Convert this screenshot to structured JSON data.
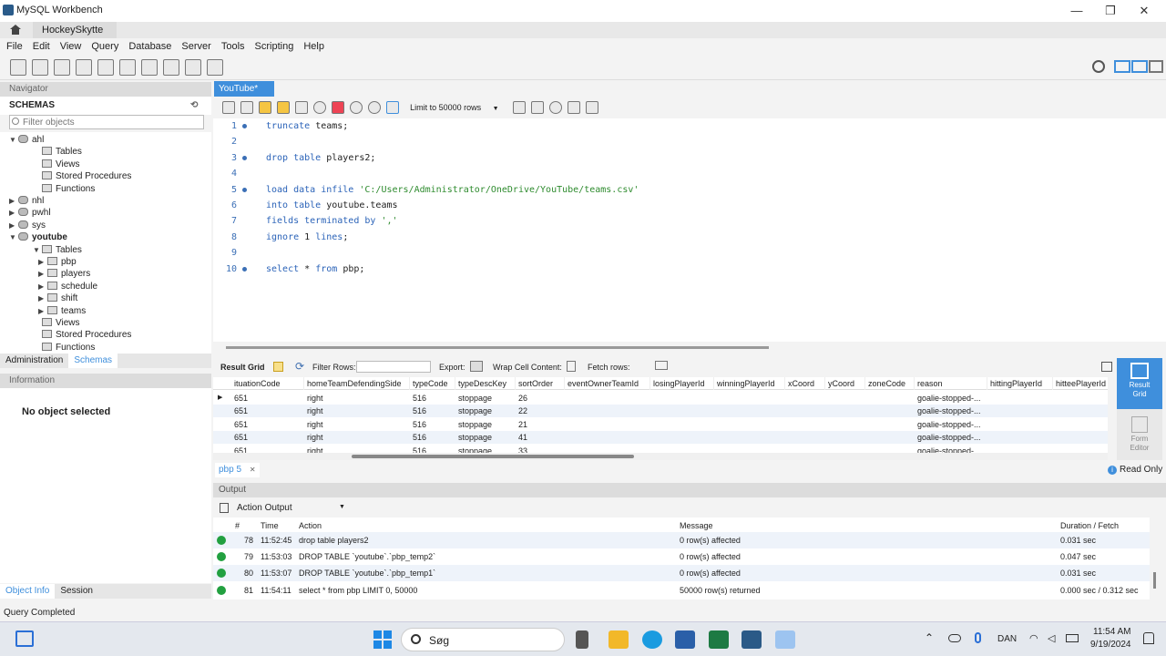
{
  "window": {
    "title": "MySQL Workbench",
    "minimize": "—",
    "maximize": "❐",
    "close": "✕"
  },
  "connection_tab": {
    "label": "HockeySkytte",
    "close": "✕"
  },
  "menu": [
    "File",
    "Edit",
    "View",
    "Query",
    "Database",
    "Server",
    "Tools",
    "Scripting",
    "Help"
  ],
  "navigator": {
    "title": "Navigator",
    "schemas_label": "SCHEMAS",
    "filter_placeholder": "Filter objects",
    "tree": [
      {
        "label": "ahl",
        "level": 0,
        "expanded": true,
        "bold": false
      },
      {
        "label": "Tables",
        "level": 1
      },
      {
        "label": "Views",
        "level": 1
      },
      {
        "label": "Stored Procedures",
        "level": 1
      },
      {
        "label": "Functions",
        "level": 1
      },
      {
        "label": "nhl",
        "level": 0,
        "expanded": false
      },
      {
        "label": "pwhl",
        "level": 0,
        "expanded": false
      },
      {
        "label": "sys",
        "level": 0,
        "expanded": false
      },
      {
        "label": "youtube",
        "level": 0,
        "expanded": true,
        "bold": true
      },
      {
        "label": "Tables",
        "level": 1,
        "expanded": true
      },
      {
        "label": "pbp",
        "level": 2
      },
      {
        "label": "players",
        "level": 2
      },
      {
        "label": "schedule",
        "level": 2
      },
      {
        "label": "shift",
        "level": 2
      },
      {
        "label": "teams",
        "level": 2
      },
      {
        "label": "Views",
        "level": 1
      },
      {
        "label": "Stored Procedures",
        "level": 1
      },
      {
        "label": "Functions",
        "level": 1
      }
    ],
    "bottom_tabs": [
      "Administration",
      "Schemas"
    ],
    "info_title": "Information",
    "no_object": "No object selected",
    "info_tabs": [
      "Object Info",
      "Session"
    ]
  },
  "editor": {
    "tab_label": "YouTube*",
    "tab_close": "✕",
    "limit_label": "Limit to 50000 rows",
    "lines": [
      {
        "n": "1",
        "dot": true,
        "tokens": [
          [
            "kw",
            "truncate "
          ],
          [
            "",
            "teams;"
          ]
        ]
      },
      {
        "n": "2",
        "dot": false,
        "tokens": []
      },
      {
        "n": "3",
        "dot": true,
        "tokens": [
          [
            "kw",
            "drop table "
          ],
          [
            "",
            "players2;"
          ]
        ]
      },
      {
        "n": "4",
        "dot": false,
        "tokens": []
      },
      {
        "n": "5",
        "dot": true,
        "tokens": [
          [
            "kw",
            "load data infile "
          ],
          [
            "str",
            "'C:/Users/Administrator/OneDrive/YouTube/teams.csv'"
          ]
        ]
      },
      {
        "n": "6",
        "dot": false,
        "tokens": [
          [
            "kw",
            "into table "
          ],
          [
            "",
            "youtube.teams"
          ]
        ]
      },
      {
        "n": "7",
        "dot": false,
        "tokens": [
          [
            "kw",
            "fields terminated by "
          ],
          [
            "str",
            "','"
          ]
        ]
      },
      {
        "n": "8",
        "dot": false,
        "tokens": [
          [
            "kw",
            "ignore "
          ],
          [
            "",
            "1 "
          ],
          [
            "kw",
            "lines"
          ],
          [
            "",
            ";"
          ]
        ]
      },
      {
        "n": "9",
        "dot": false,
        "tokens": []
      },
      {
        "n": "10",
        "dot": true,
        "tokens": [
          [
            "kw",
            "select "
          ],
          [
            "",
            "* "
          ],
          [
            "kw",
            "from "
          ],
          [
            "",
            "pbp;"
          ]
        ]
      }
    ]
  },
  "result_toolbar": {
    "result_grid": "Result Grid",
    "filter_rows": "Filter Rows:",
    "export": "Export:",
    "wrap": "Wrap Cell Content:",
    "fetch": "Fetch rows:"
  },
  "grid": {
    "columns": [
      "ituationCode",
      "homeTeamDefendingSide",
      "typeCode",
      "typeDescKey",
      "sortOrder",
      "eventOwnerTeamId",
      "losingPlayerId",
      "winningPlayerId",
      "xCoord",
      "yCoord",
      "zoneCode",
      "reason",
      "hittingPlayerId",
      "hitteePlayerId"
    ],
    "rows": [
      [
        "651",
        "right",
        "516",
        "stoppage",
        "26",
        "",
        "",
        "",
        "",
        "",
        "",
        "goalie-stopped-...",
        "",
        ""
      ],
      [
        "651",
        "right",
        "516",
        "stoppage",
        "22",
        "",
        "",
        "",
        "",
        "",
        "",
        "goalie-stopped-...",
        "",
        ""
      ],
      [
        "651",
        "right",
        "516",
        "stoppage",
        "21",
        "",
        "",
        "",
        "",
        "",
        "",
        "goalie-stopped-...",
        "",
        ""
      ],
      [
        "651",
        "right",
        "516",
        "stoppage",
        "41",
        "",
        "",
        "",
        "",
        "",
        "",
        "goalie-stopped-...",
        "",
        ""
      ],
      [
        "651",
        "right",
        "516",
        "stoppage",
        "33",
        "",
        "",
        "",
        "",
        "",
        "",
        "goalie-stopped-...",
        "",
        ""
      ]
    ]
  },
  "right_panel": {
    "result_grid": "Result Grid",
    "form_editor": "Form Editor"
  },
  "result_tab": {
    "label": "pbp 5",
    "close": "✕",
    "read_only": "Read Only"
  },
  "output": {
    "title": "Output",
    "selector": "Action Output",
    "columns": [
      "#",
      "Time",
      "Action",
      "Message",
      "Duration / Fetch"
    ],
    "rows": [
      {
        "n": "78",
        "time": "11:52:45",
        "action": "drop table players2",
        "message": "0 row(s) affected",
        "duration": "0.031 sec"
      },
      {
        "n": "79",
        "time": "11:53:03",
        "action": "DROP TABLE `youtube`.`pbp_temp2`",
        "message": "0 row(s) affected",
        "duration": "0.047 sec"
      },
      {
        "n": "80",
        "time": "11:53:07",
        "action": "DROP TABLE `youtube`.`pbp_temp1`",
        "message": "0 row(s) affected",
        "duration": "0.031 sec"
      },
      {
        "n": "81",
        "time": "11:54:11",
        "action": "select * from pbp LIMIT 0, 50000",
        "message": "50000 row(s) returned",
        "duration": "0.000 sec / 0.312 sec"
      }
    ]
  },
  "status": "Query Completed",
  "taskbar": {
    "search": "Søg",
    "lang": "DAN",
    "time": "11:54 AM",
    "date": "9/19/2024"
  }
}
